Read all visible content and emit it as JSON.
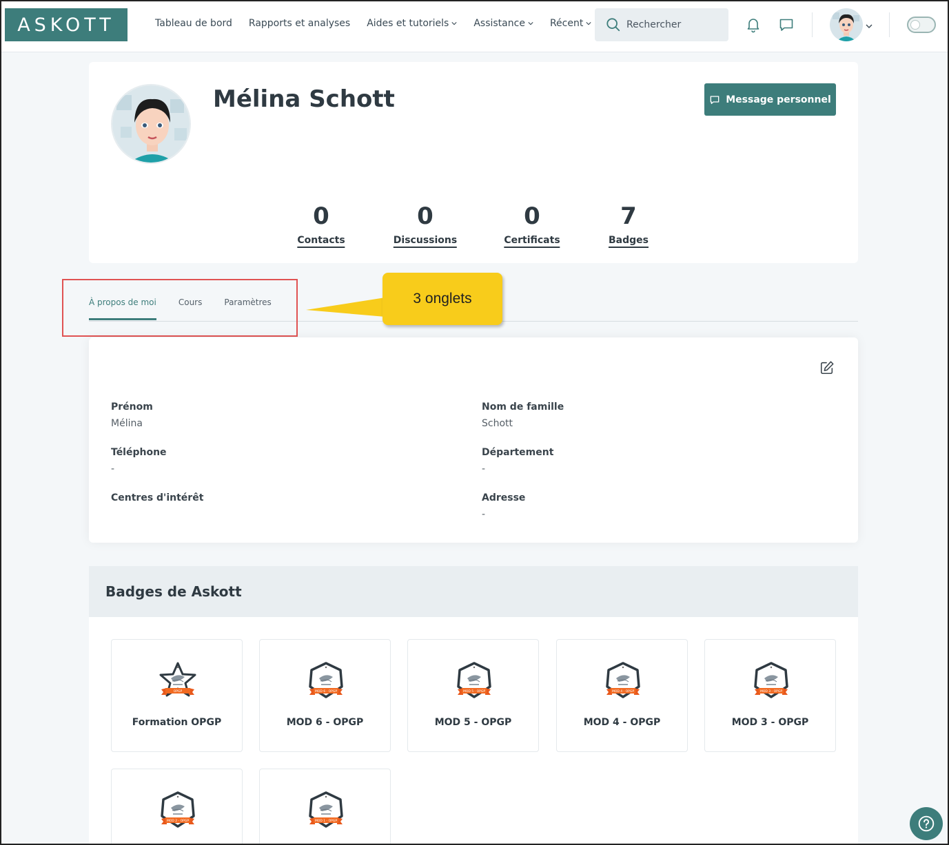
{
  "header": {
    "logo": "ASKOTT",
    "nav": [
      {
        "label": "Tableau de bord",
        "dropdown": false
      },
      {
        "label": "Rapports et analyses",
        "dropdown": false
      },
      {
        "label": "Aides et tutoriels",
        "dropdown": true
      },
      {
        "label": "Assistance",
        "dropdown": true
      },
      {
        "label": "Récent",
        "dropdown": true
      }
    ],
    "search_placeholder": "Rechercher"
  },
  "profile": {
    "name": "Mélina Schott",
    "message_button": "Message personnel",
    "stats": [
      {
        "value": "0",
        "label": "Contacts"
      },
      {
        "value": "0",
        "label": "Discussions"
      },
      {
        "value": "0",
        "label": "Certificats"
      },
      {
        "value": "7",
        "label": "Badges"
      }
    ]
  },
  "tabs": [
    {
      "label": "À propos de moi",
      "active": true
    },
    {
      "label": "Cours",
      "active": false
    },
    {
      "label": "Paramètres",
      "active": false
    }
  ],
  "annotation": {
    "callout": "3 onglets"
  },
  "about": {
    "fields": [
      {
        "label": "Prénom",
        "value": "Mélina"
      },
      {
        "label": "Nom de famille",
        "value": "Schott"
      },
      {
        "label": "Téléphone",
        "value": "-"
      },
      {
        "label": "Département",
        "value": "-"
      },
      {
        "label": "Centres d'intérêt",
        "value": ""
      },
      {
        "label": "Adresse",
        "value": "-"
      }
    ]
  },
  "badges": {
    "title": "Badges de Askott",
    "items": [
      {
        "name": "Formation OPGP",
        "ribbon": "OPGP",
        "shape": "star"
      },
      {
        "name": "MOD 6 - OPGP",
        "ribbon": "MOD 6 - OPGP",
        "shape": "hexagon"
      },
      {
        "name": "MOD 5 - OPGP",
        "ribbon": "MOD 5 - OPGP",
        "shape": "hexagon"
      },
      {
        "name": "MOD 4 - OPGP",
        "ribbon": "MOD 4 - OPGP",
        "shape": "hexagon"
      },
      {
        "name": "MOD 3 - OPGP",
        "ribbon": "MOD 3 - OPGP",
        "shape": "hexagon"
      },
      {
        "name": "",
        "ribbon": "MOD 2 - OPGP",
        "shape": "hexagon"
      },
      {
        "name": "",
        "ribbon": "MOD 1 - OPGP",
        "shape": "hexagon"
      }
    ]
  },
  "colors": {
    "brand": "#3d7d7b",
    "callout": "#f8cc1b",
    "highlight_border": "#e05252"
  }
}
